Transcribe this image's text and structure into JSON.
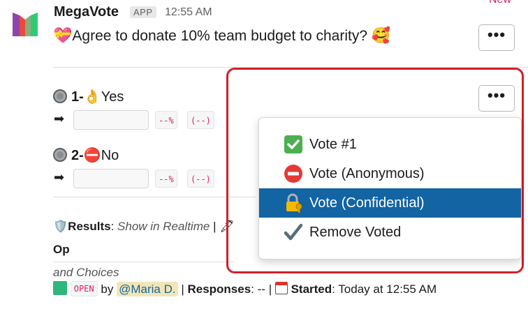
{
  "message": {
    "app_name": "MegaVote",
    "app_badge": "APP",
    "timestamp": "12:55 AM",
    "new_label": "New",
    "question": "Agree to donate 10% team budget to charity?",
    "more_label": "…"
  },
  "options": [
    {
      "number": "1-",
      "label": "Yes",
      "percent": "--%",
      "count": "(--)"
    },
    {
      "number": "2-",
      "label": "No",
      "percent": "--%",
      "count": "(--)"
    }
  ],
  "meta": {
    "results_label": "Results",
    "results_value": "Show in Realtime",
    "separator": "|",
    "truncated_tail": "Op",
    "wrapped_text": "and Choices"
  },
  "footer": {
    "status": "OPEN",
    "by": "by",
    "author": "@Maria D.",
    "separator": "|",
    "responses_label": "Responses",
    "responses_value": "--",
    "started_label": "Started",
    "started_value": "Today at 12:55 AM"
  },
  "menu": {
    "items": [
      {
        "label": "Vote #1",
        "icon": "check-mark-button-icon"
      },
      {
        "label": "Vote (Anonymous)",
        "icon": "no-entry-icon"
      },
      {
        "label": "Vote (Confidential)",
        "icon": "locked-with-key-icon",
        "selected": true
      },
      {
        "label": "Remove Voted",
        "icon": "check-mark-icon"
      }
    ]
  },
  "colors": {
    "highlight": "#d0202b",
    "selected": "#1264a3",
    "code_text": "#e01e5a",
    "open_status": "#2eb67d"
  }
}
